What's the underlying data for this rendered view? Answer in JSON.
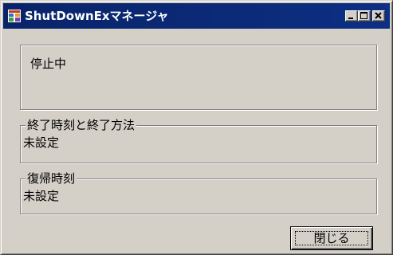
{
  "window": {
    "title": "ShutDownExマネージャ",
    "icon": "app-window-icon"
  },
  "status": {
    "text": "停止中"
  },
  "shutdown_group": {
    "legend": "終了時刻と終了方法",
    "value": "未設定"
  },
  "resume_group": {
    "legend": "復帰時刻",
    "value": "未設定"
  },
  "buttons": {
    "close_label": "閉じる"
  },
  "colors": {
    "title_bar": "#0a246a",
    "face": "#d4d0c8"
  }
}
